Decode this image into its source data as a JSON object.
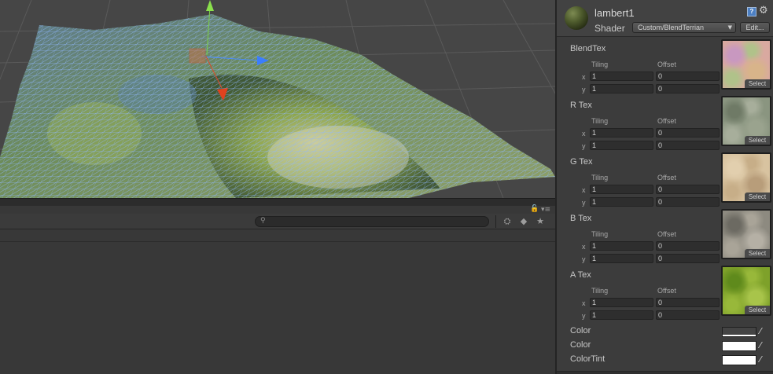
{
  "material": {
    "name": "lambert1",
    "shader_label": "Shader",
    "shader_value": "Custom/BlendTerrian",
    "edit_label": "Edit...",
    "help_icon": "help-icon",
    "settings_icon": "gear-icon"
  },
  "columns": {
    "tiling": "Tiling",
    "offset": "Offset",
    "x": "x",
    "y": "y"
  },
  "textures": [
    {
      "name": "BlendTex",
      "tiling_x": "1",
      "tiling_y": "1",
      "offset_x": "0",
      "offset_y": "0",
      "select_label": "Select",
      "colors": [
        "#d9a9a0",
        "#b0c28a",
        "#c898c0",
        "#d8b48a"
      ]
    },
    {
      "name": "R Tex",
      "tiling_x": "1",
      "tiling_y": "1",
      "offset_x": "0",
      "offset_y": "0",
      "select_label": "Select",
      "colors": [
        "#8a9580",
        "#a7ae9b",
        "#6f7a66",
        "#9aa38e"
      ]
    },
    {
      "name": "G Tex",
      "tiling_x": "1",
      "tiling_y": "1",
      "offset_x": "0",
      "offset_y": "0",
      "select_label": "Select",
      "colors": [
        "#d8c3a0",
        "#c7ae88",
        "#e2cfae",
        "#b89d7a"
      ]
    },
    {
      "name": "B Tex",
      "tiling_x": "1",
      "tiling_y": "1",
      "offset_x": "0",
      "offset_y": "0",
      "select_label": "Select",
      "colors": [
        "#8d8a80",
        "#a9a498",
        "#6c6a62",
        "#b5b0a5"
      ]
    },
    {
      "name": "A Tex",
      "tiling_x": "1",
      "tiling_y": "1",
      "offset_x": "0",
      "offset_y": "0",
      "select_label": "Select",
      "colors": [
        "#7ea12a",
        "#98b83a",
        "#5f8a1c",
        "#a8c44a"
      ]
    }
  ],
  "colors": [
    {
      "label": "Color",
      "value": "#444444"
    },
    {
      "label": "Color",
      "value": "#ffffff"
    },
    {
      "label": "ColorTint",
      "value": "#ffffff"
    }
  ],
  "project": {
    "search_placeholder": "",
    "icons": [
      "lock-icon",
      "menu-icon",
      "filter-by-type-icon",
      "filter-by-label-icon",
      "favorites-star-icon"
    ]
  }
}
